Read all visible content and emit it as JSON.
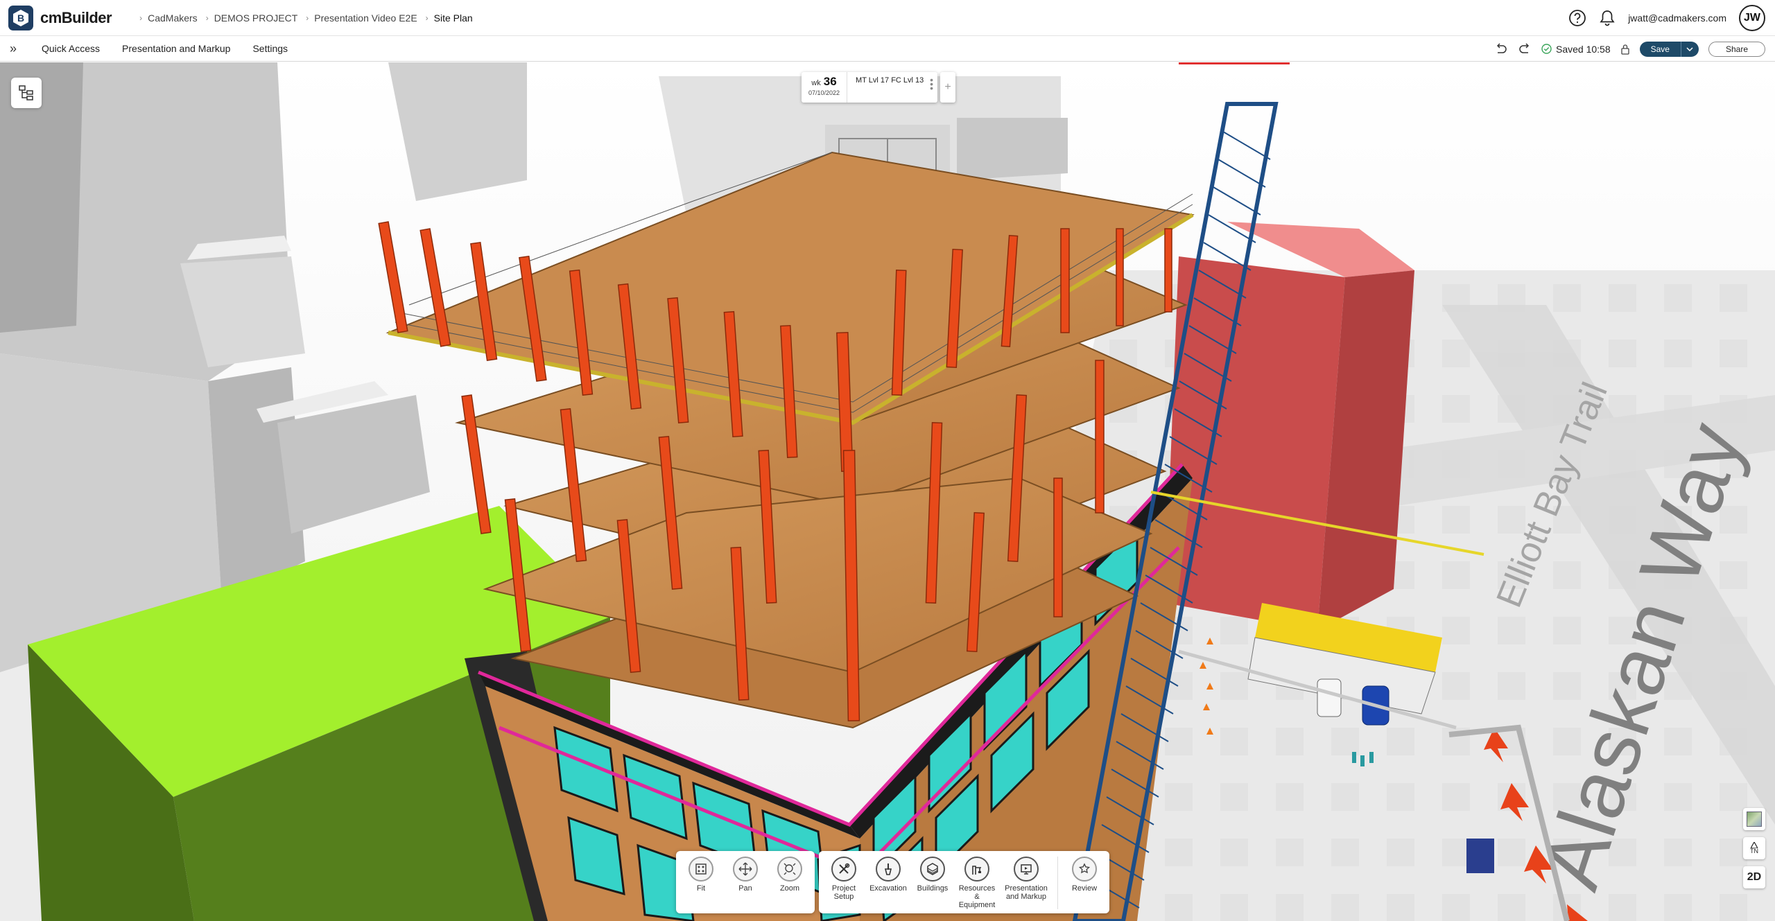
{
  "app": {
    "name": "cmBuilder",
    "logo_letter": "B"
  },
  "breadcrumb": [
    "CadMakers",
    "DEMOS PROJECT",
    "Presentation Video E2E",
    "Site Plan"
  ],
  "user": {
    "email": "jwatt@cadmakers.com",
    "initials": "JW"
  },
  "menu": {
    "items": [
      "Quick Access",
      "Presentation and Markup",
      "Settings"
    ]
  },
  "status": {
    "saved_text": "Saved 10:58"
  },
  "actions": {
    "save_label": "Save",
    "share_label": "Share"
  },
  "schedule": {
    "week_prefix": "wk",
    "week_number": "36",
    "date": "07/10/2022",
    "phase": "MT Lvl 17 FC Lvl 13"
  },
  "toolbar": {
    "view": [
      {
        "label": "Fit",
        "icon": "fit-icon"
      },
      {
        "label": "Pan",
        "icon": "pan-icon"
      },
      {
        "label": "Zoom",
        "icon": "zoom-icon"
      }
    ],
    "tools": [
      {
        "label": "Project\nSetup",
        "icon": "project-setup-icon"
      },
      {
        "label": "Excavation",
        "icon": "excavation-icon"
      },
      {
        "label": "Buildings",
        "icon": "buildings-icon"
      },
      {
        "label": "Resources &\nEquipment",
        "icon": "resources-icon"
      },
      {
        "label": "Presentation\nand Markup",
        "icon": "presentation-icon"
      },
      {
        "label": "Review",
        "icon": "review-icon"
      }
    ]
  },
  "side": {
    "north_label": "TN",
    "view_mode_label": "2D"
  },
  "scene": {
    "street_names": [
      "Elliott Bay Trail",
      "Alaskan Way"
    ],
    "colors": {
      "column": "#e84a1a",
      "slab": "#c8874c",
      "glass": "#36d3c8",
      "trim": "#e0289a",
      "crane": "#1e4e86",
      "lime_block": "#a3ef2d",
      "red_block": "#c94c4c",
      "brand": "#1f3e63",
      "save": "#1e4a68"
    }
  }
}
